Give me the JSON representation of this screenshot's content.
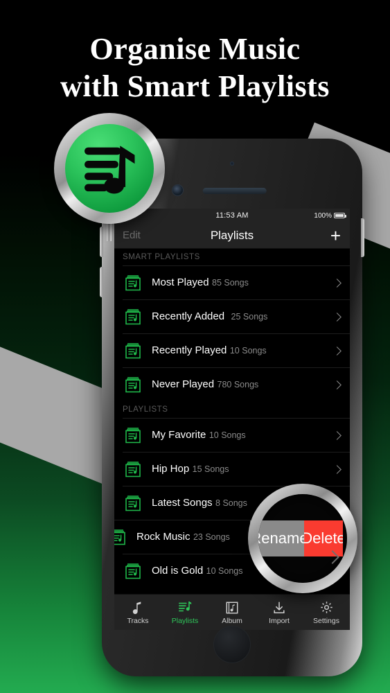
{
  "headline": {
    "line1": "Organise  Music",
    "line2": "with  Smart  Playlists"
  },
  "app_icon": {
    "name": "playlist-music-app-icon"
  },
  "colors": {
    "accent_green": "#2fc65a",
    "icon_green": "#1fb84a",
    "delete_red": "#fa3b30",
    "rename_gray": "#8a8a8a",
    "bar_bg": "#232323",
    "bg_bottom_green": "#23ab50"
  },
  "status_bar": {
    "time": "11:53 AM",
    "battery_percent": "100%"
  },
  "nav_bar": {
    "edit_label": "Edit",
    "title": "Playlists",
    "add_label": "+"
  },
  "sections": [
    {
      "header": "SMART PLAYLISTS",
      "rows": [
        {
          "title": "Most Played",
          "subtitle": "85 Songs"
        },
        {
          "title": "Recently Added",
          "subtitle": "25 Songs"
        },
        {
          "title": "Recently Played",
          "subtitle": "10 Songs"
        },
        {
          "title": "Never Played",
          "subtitle": "780 Songs"
        }
      ]
    },
    {
      "header": "PLAYLISTS",
      "rows": [
        {
          "title": "My Favorite",
          "subtitle": "10 Songs"
        },
        {
          "title": "Hip Hop",
          "subtitle": "15 Songs"
        },
        {
          "title": "Latest Songs",
          "subtitle": "8 Songs"
        },
        {
          "title": "Rock Music",
          "subtitle": "23 Songs"
        },
        {
          "title": "Old is Gold",
          "subtitle": "10 Songs"
        }
      ]
    }
  ],
  "swipe_actions": {
    "rename_label": "Rename",
    "delete_label": "Delete"
  },
  "magnifier": {
    "rename_label": "Rename",
    "delete_label": "Delete"
  },
  "tab_bar": {
    "tabs": [
      {
        "label": "Tracks",
        "icon": "music-note-icon",
        "active": false
      },
      {
        "label": "Playlists",
        "icon": "playlist-icon",
        "active": true
      },
      {
        "label": "Album",
        "icon": "album-icon",
        "active": false
      },
      {
        "label": "Import",
        "icon": "download-arrow-icon",
        "active": false
      },
      {
        "label": "Settings",
        "icon": "gear-icon",
        "active": false
      }
    ]
  }
}
